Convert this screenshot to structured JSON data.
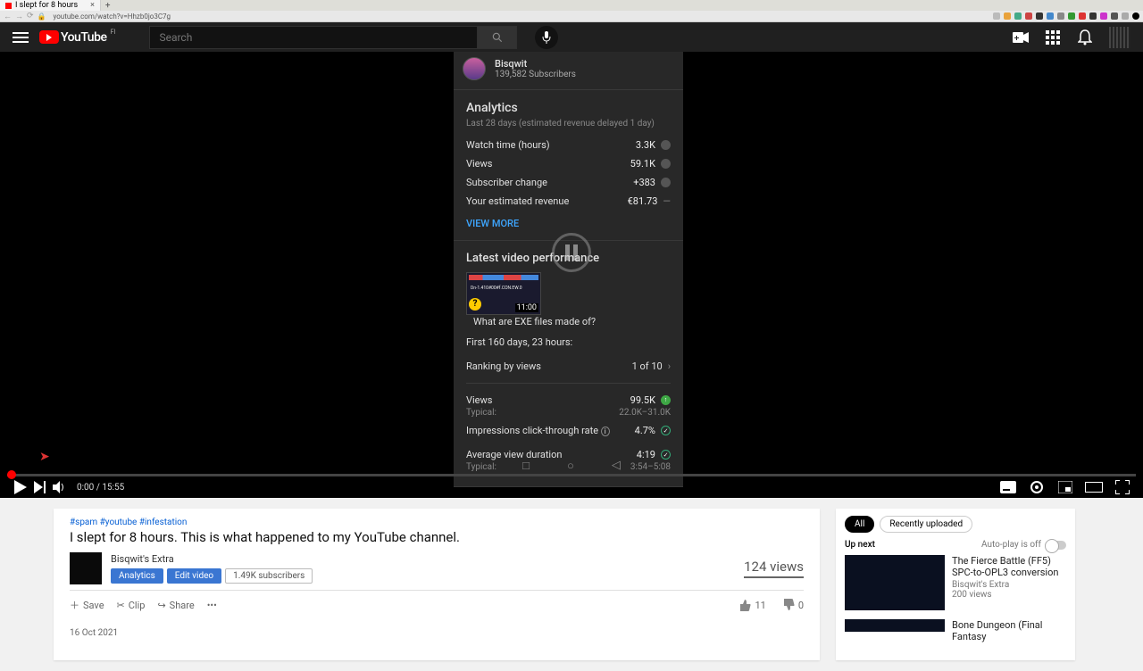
{
  "browser": {
    "tab_title": "I slept for 8 hours",
    "url": "youtube.com/watch?v=Hhzb0jo3C7g"
  },
  "header": {
    "logo_text": "YouTube",
    "logo_locale": "FI",
    "search_placeholder": "Search"
  },
  "panel": {
    "channel": "Bisqwit",
    "subs": "139,582 Subscribers",
    "analytics_title": "Analytics",
    "analytics_note": "Last 28 days (estimated revenue delayed 1 day)",
    "watch_label": "Watch time (hours)",
    "watch_val": "3.3K",
    "views_label": "Views",
    "views_val": "59.1K",
    "subchange_label": "Subscriber change",
    "subchange_val": "+383",
    "revenue_label": "Your estimated revenue",
    "revenue_val": "€81.73",
    "view_more": "VIEW MORE",
    "latest_title": "Latest video performance",
    "latest_video_title": "What are EXE files made of?",
    "latest_dur": "11:00",
    "thumb_line": "Dn-1.410#00#f.CON.EW.0",
    "first_period": "First 160 days, 23 hours:",
    "ranking_label": "Ranking by views",
    "ranking_val": "1 of 10",
    "lv_views_label": "Views",
    "lv_views_val": "99.5K",
    "lv_views_typ": "22.0K–31.0K",
    "ctr_label": "Impressions click-through rate",
    "ctr_val": "4.7%",
    "avd_label": "Average view duration",
    "avd_val": "4:19",
    "avd_typ": "3:54–5:08",
    "typical": "Typical:"
  },
  "player": {
    "time": "0:00 / 15:55"
  },
  "video": {
    "hashtags": "#spam #youtube #infestation",
    "title": "I slept for 8 hours. This is what happened to my YouTube channel.",
    "channel": "Bisqwit's Extra",
    "pill_analytics": "Analytics",
    "pill_edit": "Edit video",
    "pill_subs": "1.49K subscribers",
    "views": "124 views",
    "save": "Save",
    "clip": "Clip",
    "share": "Share",
    "likes": "11",
    "dislikes": "0",
    "date": "16 Oct 2021"
  },
  "sidebar": {
    "chip_all": "All",
    "chip_recent": "Recently uploaded",
    "upnext": "Up next",
    "autoplay": "Auto-play is off",
    "rec1_title": "The Fierce Battle (FF5) SPC-to-OPL3 conversion",
    "rec1_channel": "Bisqwit's Extra",
    "rec1_views": "200 views",
    "rec2_title": "Bone Dungeon (Final Fantasy"
  }
}
